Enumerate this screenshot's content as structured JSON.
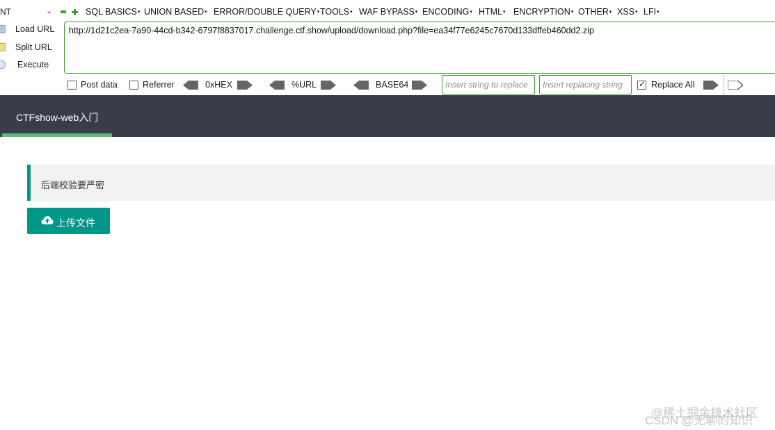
{
  "hackbar": {
    "mode_select": "NT",
    "menu": [
      "SQL BASICS",
      "UNION BASED",
      "ERROR/DOUBLE QUERY",
      "TOOLS",
      "WAF BYPASS",
      "ENCODING",
      "HTML",
      "ENCRYPTION",
      "OTHER",
      "XSS",
      "LFI"
    ],
    "actions": {
      "load": "Load URL",
      "split": "Split URL",
      "execute": "Execute"
    },
    "url": "http://1d21c2ea-7a90-44cd-b342-6797f8837017.challenge.ctf.show/upload/download.php?file=ea34f77e6245c7670d133dffeb460dd2.zip",
    "options": {
      "post_data": "Post data",
      "referrer": "Referrer",
      "replace_all": "Replace All"
    },
    "encoders": {
      "hex": "0xHEX",
      "url": "%URL",
      "base64": "BASE64"
    },
    "replace_placeholder": "Insert string to replace",
    "replacing_placeholder": "Insert replacing string",
    "accent_color": "#3c9a2e"
  },
  "nav": {
    "active_item": "CTFshow-web入门",
    "bg_color": "#393d49",
    "indicator_color": "#5fb878"
  },
  "content": {
    "notice": "后端校验要严密",
    "upload_button": "上传文件",
    "button_color": "#009688"
  },
  "watermarks": {
    "juejin": "@稀土掘金技术社区",
    "csdn": "CSDN @无聊的知识"
  }
}
